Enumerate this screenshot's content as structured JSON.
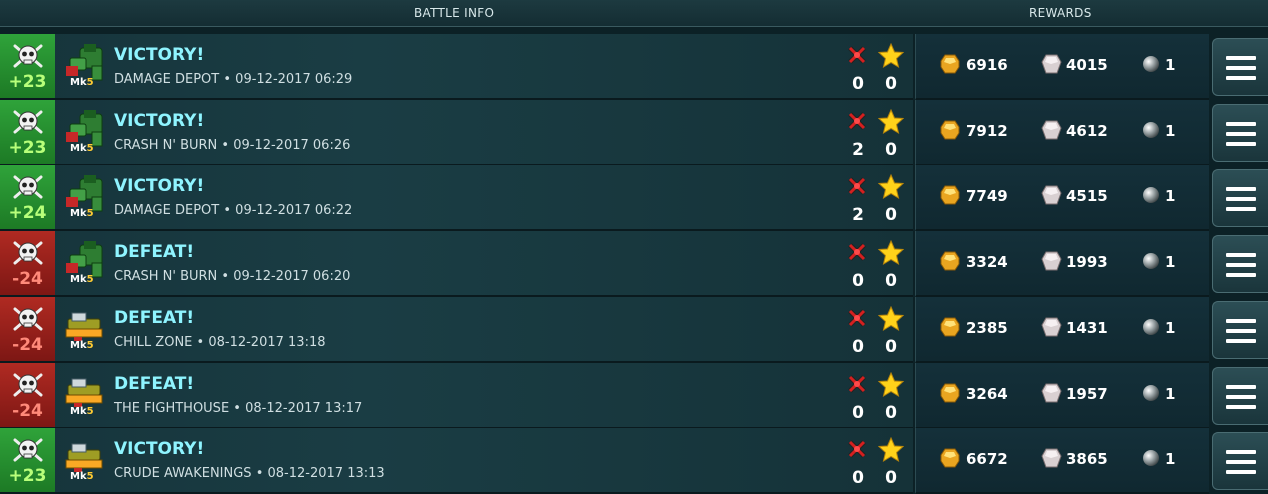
{
  "header": {
    "battle_info": "BATTLE INFO",
    "rewards": "REWARDS"
  },
  "colors": {
    "win": "#2fa33a",
    "loss": "#b02a22",
    "title": "#8ff4ff"
  },
  "battles": [
    {
      "result": "win",
      "trophies": "+23",
      "mk": "Mk",
      "mk_level": "5",
      "robot": "green",
      "title": "VICTORY!",
      "map": "DAMAGE DEPOT",
      "date": "09-12-2017 06:29",
      "kills": "0",
      "stars": "0",
      "gold": "6916",
      "silver": "4015",
      "orbs": "1"
    },
    {
      "result": "win",
      "trophies": "+23",
      "mk": "Mk",
      "mk_level": "5",
      "robot": "green",
      "title": "VICTORY!",
      "map": "CRASH N' BURN",
      "date": "09-12-2017 06:26",
      "kills": "2",
      "stars": "0",
      "gold": "7912",
      "silver": "4612",
      "orbs": "1"
    },
    {
      "result": "win",
      "trophies": "+24",
      "mk": "Mk",
      "mk_level": "5",
      "robot": "green",
      "title": "VICTORY!",
      "map": "DAMAGE DEPOT",
      "date": "09-12-2017 06:22",
      "kills": "2",
      "stars": "0",
      "gold": "7749",
      "silver": "4515",
      "orbs": "1"
    },
    {
      "result": "loss",
      "trophies": "-24",
      "mk": "Mk",
      "mk_level": "5",
      "robot": "green",
      "title": "DEFEAT!",
      "map": "CRASH N' BURN",
      "date": "09-12-2017 06:20",
      "kills": "0",
      "stars": "0",
      "gold": "3324",
      "silver": "1993",
      "orbs": "1"
    },
    {
      "result": "loss",
      "trophies": "-24",
      "mk": "Mk",
      "mk_level": "5",
      "robot": "yellow",
      "title": "DEFEAT!",
      "map": "CHILL ZONE",
      "date": "08-12-2017 13:18",
      "kills": "0",
      "stars": "0",
      "gold": "2385",
      "silver": "1431",
      "orbs": "1"
    },
    {
      "result": "loss",
      "trophies": "-24",
      "mk": "Mk",
      "mk_level": "5",
      "robot": "yellow",
      "title": "DEFEAT!",
      "map": "THE FIGHTHOUSE",
      "date": "08-12-2017 13:17",
      "kills": "0",
      "stars": "0",
      "gold": "3264",
      "silver": "1957",
      "orbs": "1"
    },
    {
      "result": "win",
      "trophies": "+23",
      "mk": "Mk",
      "mk_level": "5",
      "robot": "yellow",
      "title": "VICTORY!",
      "map": "CRUDE AWAKENINGS",
      "date": "08-12-2017 13:13",
      "kills": "0",
      "stars": "0",
      "gold": "6672",
      "silver": "3865",
      "orbs": "1"
    }
  ],
  "separator": "•"
}
